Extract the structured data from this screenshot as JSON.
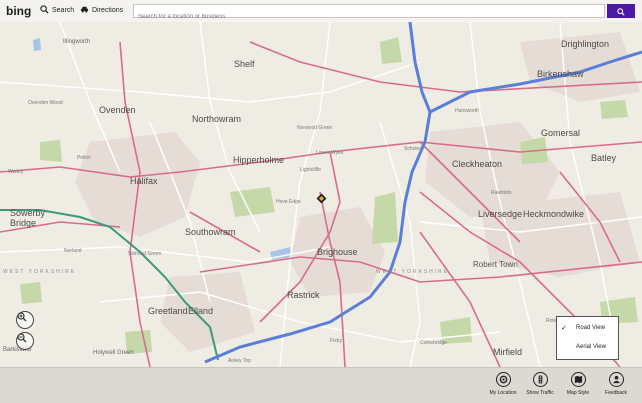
{
  "topbar": {
    "logo": "bing",
    "search_label": "Search",
    "directions_label": "Directions",
    "search_placeholder": "Search for a location or business"
  },
  "map": {
    "labels": {
      "illingworth": "Illingworth",
      "shelf": "Shelf",
      "drighlington": "Drighlington",
      "birkenshaw": "Birkenshaw",
      "ovenden_wood": "Ovenden Wood",
      "ovenden": "Ovenden",
      "northowram": "Northowram",
      "gomersal": "Gomersal",
      "batley": "Batley",
      "hipperholme": "Hipperholme",
      "cleckheaton": "Cleckheaton",
      "halifax": "Halifax",
      "liversedge": "Liversedge",
      "heckmondwike": "Heckmondwike",
      "sowerby_bridge": "Sowerby\nBridge",
      "southowram": "Southowram",
      "brighouse": "Brighouse",
      "robert_town": "Robert Town",
      "west_yorkshire": "WEST YORKSHIRE",
      "rastrick": "Rastrick",
      "greetland": "Greetland",
      "elland": "Elland",
      "mirfield": "Mirfield",
      "holywell_green": "Holywell Green",
      "barkisland": "Barkisland",
      "lightcliffe": "Lightcliffe",
      "hove_edge": "Hove Edge",
      "norwood_green": "Norwood Green",
      "lower_wyke": "Lower Wyke",
      "scholes": "Scholes",
      "hunsworth": "Hunsworth",
      "norland": "Norland",
      "skircoat_green": "Skircoat Green",
      "pellon": "Pellon",
      "warley": "Warley",
      "roberttown_lane": "Roberttown Lane",
      "fixby": "Fixby",
      "colnebridge": "Colnebridge",
      "ainley_top": "Ainley Top",
      "rawfolds": "Rawfolds"
    }
  },
  "view_menu": {
    "road_view": "Road View",
    "aerial_view": "Aerial View",
    "checked": "✓"
  },
  "appbar": {
    "my_location": "My Location",
    "show_traffic": "Show Traffic",
    "map_style": "Map Style",
    "feedback": "Feedback"
  },
  "colors": {
    "motorway": "#5b7fd8",
    "a_road": "#d96b8a",
    "rail": "#3a9a7a",
    "search_button": "#4a1aa6"
  }
}
